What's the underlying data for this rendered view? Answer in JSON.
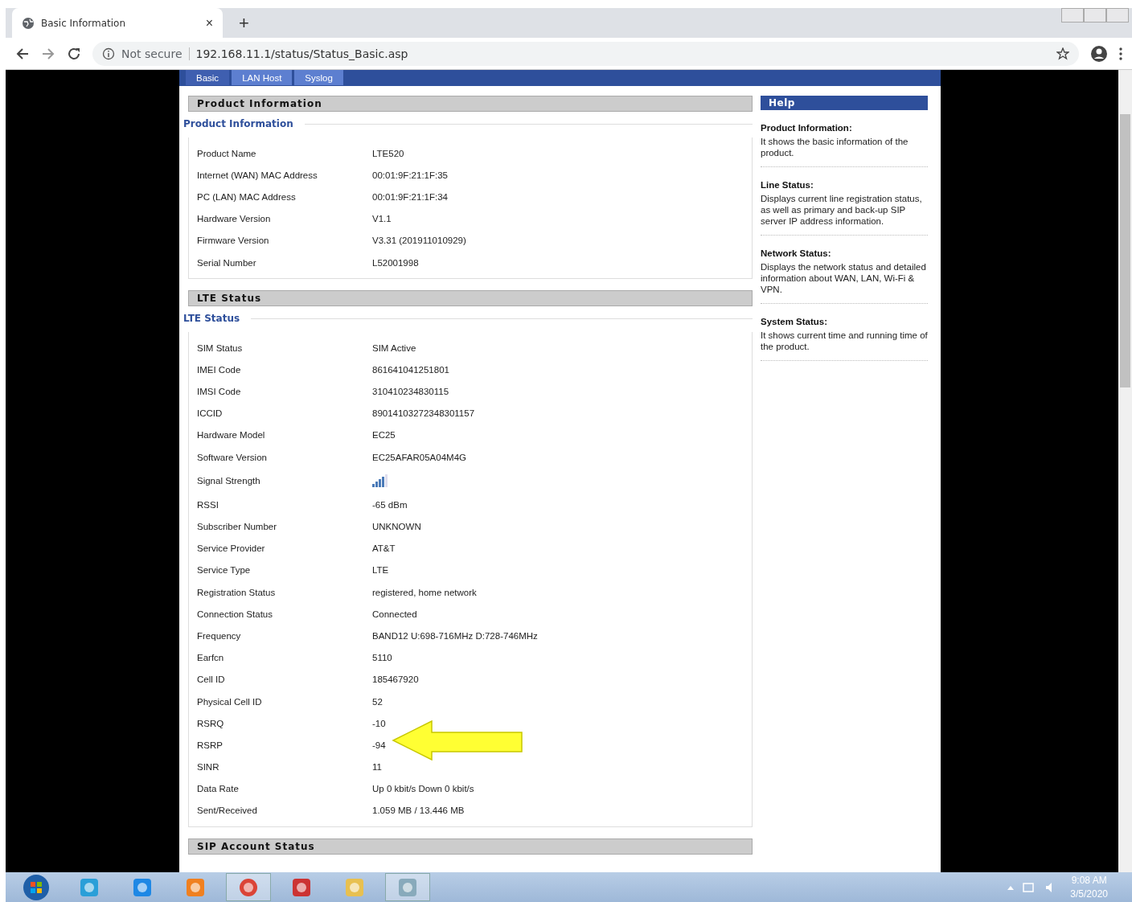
{
  "browser": {
    "tab_title": "Basic Information",
    "new_tab": "+",
    "close_tab": "×",
    "security": "Not secure",
    "url": "192.168.11.1/status/Status_Basic.asp"
  },
  "nav_tabs": [
    {
      "label": "Basic",
      "selected": true
    },
    {
      "label": "LAN Host",
      "selected": false
    },
    {
      "label": "Syslog",
      "selected": false
    }
  ],
  "sections": [
    {
      "header": "Product Information",
      "legend": "Product Information",
      "rows": [
        {
          "kind": "text",
          "label": "Product Name",
          "value": "LTE520"
        },
        {
          "kind": "text",
          "label": "Internet (WAN) MAC Address",
          "value": "00:01:9F:21:1F:35"
        },
        {
          "kind": "text",
          "label": "PC (LAN) MAC Address",
          "value": "00:01:9F:21:1F:34"
        },
        {
          "kind": "text",
          "label": "Hardware Version",
          "value": "V1.1"
        },
        {
          "kind": "text",
          "label": "Firmware Version",
          "value": "V3.31 (201911010929)"
        },
        {
          "kind": "text",
          "label": "Serial Number",
          "value": "L52001998"
        }
      ]
    },
    {
      "header": "LTE Status",
      "legend": "LTE Status",
      "rows": [
        {
          "kind": "text",
          "label": "SIM Status",
          "value": "SIM Active"
        },
        {
          "kind": "text",
          "label": "IMEI Code",
          "value": "861641041251801"
        },
        {
          "kind": "text",
          "label": "IMSI Code",
          "value": "310410234830115"
        },
        {
          "kind": "text",
          "label": "ICCID",
          "value": "89014103272348301157"
        },
        {
          "kind": "text",
          "label": "Hardware Model",
          "value": "EC25"
        },
        {
          "kind": "text",
          "label": "Software Version",
          "value": "EC25AFAR05A04M4G"
        },
        {
          "kind": "signal",
          "label": "Signal Strength"
        },
        {
          "kind": "text",
          "label": "RSSI",
          "value": "-65 dBm"
        },
        {
          "kind": "text",
          "label": "Subscriber Number",
          "value": "UNKNOWN"
        },
        {
          "kind": "text",
          "label": "Service Provider",
          "value": "AT&T"
        },
        {
          "kind": "text",
          "label": "Service Type",
          "value": "LTE"
        },
        {
          "kind": "text",
          "label": "Registration Status",
          "value": "registered, home network"
        },
        {
          "kind": "text",
          "label": "Connection Status",
          "value": "Connected"
        },
        {
          "kind": "text",
          "label": "Frequency",
          "value": "BAND12 U:698-716MHz D:728-746MHz"
        },
        {
          "kind": "text",
          "label": "Earfcn",
          "value": "5110"
        },
        {
          "kind": "text",
          "label": "Cell ID",
          "value": "185467920"
        },
        {
          "kind": "text",
          "label": "Physical Cell ID",
          "value": "52"
        },
        {
          "kind": "text",
          "label": "RSRQ",
          "value": "-10"
        },
        {
          "kind": "text",
          "label": "RSRP",
          "value": "-94"
        },
        {
          "kind": "text",
          "label": "SINR",
          "value": "11"
        },
        {
          "kind": "text",
          "label": "Data Rate",
          "value": "Up 0 kbit/s Down 0 kbit/s"
        },
        {
          "kind": "text",
          "label": "Sent/Received",
          "value": "1.059 MB  /  13.446 MB"
        }
      ]
    },
    {
      "header": "SIP Account Status"
    }
  ],
  "help": {
    "title": "Help",
    "items": [
      {
        "heading": "Product Information:",
        "text": "It shows the basic information of the product."
      },
      {
        "heading": "Line Status:",
        "text": "Displays current line registration status, as well as primary and back-up SIP server IP address information."
      },
      {
        "heading": "Network Status:",
        "text": "Displays the network status and detailed information about WAN, LAN, Wi-Fi & VPN."
      },
      {
        "heading": "System Status:",
        "text": "It shows current time and running time of the product."
      }
    ]
  },
  "taskbar": {
    "time": "9:08 AM",
    "date": "3/5/2020"
  }
}
